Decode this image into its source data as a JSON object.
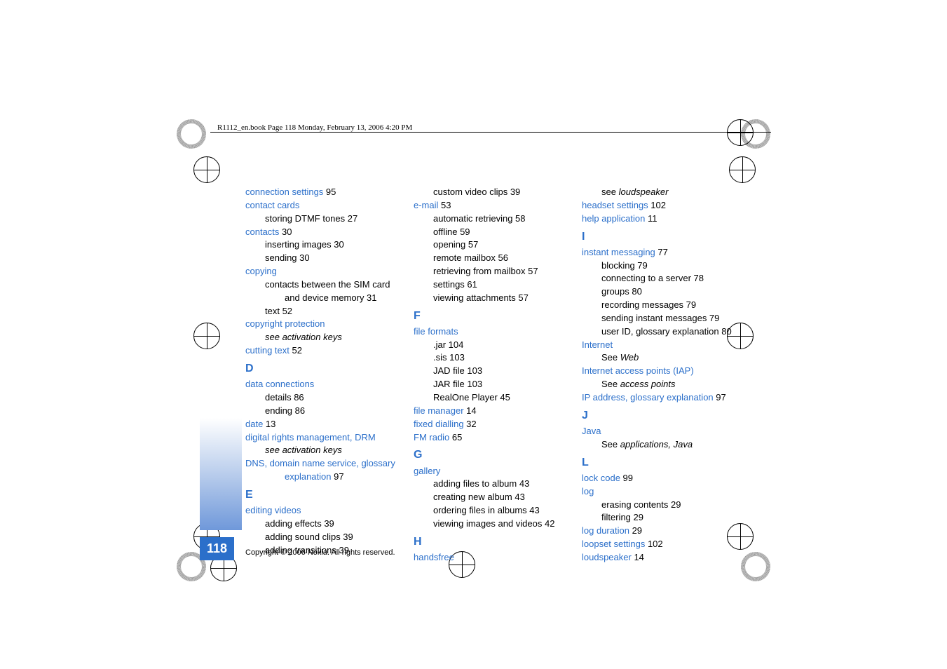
{
  "header": "R1112_en.book  Page 118  Monday, February 13, 2006  4:20 PM",
  "page_number": "118",
  "copyright": "Copyright © 2006 Nokia. All rights reserved.",
  "col1": [
    {
      "cls": "link",
      "txt": "connection settings",
      "pg": " 95"
    },
    {
      "cls": "link",
      "txt": "contact cards"
    },
    {
      "cls": "indent1",
      "txt": "storing DTMF tones 27"
    },
    {
      "cls": "link",
      "txt": "contacts",
      "pg": " 30"
    },
    {
      "cls": "indent1",
      "txt": "inserting images 30"
    },
    {
      "cls": "indent1",
      "txt": "sending 30"
    },
    {
      "cls": "link",
      "txt": "copying"
    },
    {
      "cls": "indent1",
      "txt": "contacts between the SIM card"
    },
    {
      "cls": "indent2",
      "txt": "and device memory 31"
    },
    {
      "cls": "indent1",
      "txt": "text 52"
    },
    {
      "cls": "link",
      "txt": "copyright protection"
    },
    {
      "cls": "indent1 ital",
      "txt": "see activation keys"
    },
    {
      "cls": "link",
      "txt": "cutting text",
      "pg": " 52"
    },
    {
      "cls": "sect",
      "txt": "D"
    },
    {
      "cls": "link",
      "txt": "data connections"
    },
    {
      "cls": "indent1",
      "txt": "details 86"
    },
    {
      "cls": "indent1",
      "txt": "ending 86"
    },
    {
      "cls": "link",
      "txt": "date",
      "pg": " 13"
    },
    {
      "cls": "link",
      "txt": "digital rights management, DRM"
    },
    {
      "cls": "indent1 ital",
      "txt": "see activation keys"
    },
    {
      "cls": "link",
      "txt": "DNS, domain name service, glossary"
    },
    {
      "cls": "link indent2",
      "txt": "explanation",
      "pg": " 97"
    },
    {
      "cls": "sect",
      "txt": "E"
    },
    {
      "cls": "link",
      "txt": "editing videos"
    },
    {
      "cls": "indent1",
      "txt": "adding effects 39"
    },
    {
      "cls": "indent1",
      "txt": "adding sound clips 39"
    },
    {
      "cls": "indent1",
      "txt": "adding transitions 39"
    }
  ],
  "col2": [
    {
      "cls": "indent1",
      "txt": "custom video clips 39"
    },
    {
      "cls": "link",
      "txt": "e-mail",
      "pg": " 53"
    },
    {
      "cls": "indent1",
      "txt": "automatic retrieving 58"
    },
    {
      "cls": "indent1",
      "txt": "offline 59"
    },
    {
      "cls": "indent1",
      "txt": "opening 57"
    },
    {
      "cls": "indent1",
      "txt": "remote mailbox 56"
    },
    {
      "cls": "indent1",
      "txt": "retrieving from mailbox 57"
    },
    {
      "cls": "indent1",
      "txt": "settings 61"
    },
    {
      "cls": "indent1",
      "txt": "viewing attachments 57"
    },
    {
      "cls": "sect",
      "txt": "F"
    },
    {
      "cls": "link",
      "txt": "file formats"
    },
    {
      "cls": "indent1",
      "txt": ".jar 104"
    },
    {
      "cls": "indent1",
      "txt": ".sis 103"
    },
    {
      "cls": "indent1",
      "txt": "JAD file 103"
    },
    {
      "cls": "indent1",
      "txt": "JAR file 103"
    },
    {
      "cls": "indent1",
      "txt": "RealOne Player 45"
    },
    {
      "cls": "link",
      "txt": "file manager",
      "pg": " 14"
    },
    {
      "cls": "link",
      "txt": "fixed dialling",
      "pg": " 32"
    },
    {
      "cls": "link",
      "txt": "FM radio",
      "pg": " 65"
    },
    {
      "cls": "sect",
      "txt": "G"
    },
    {
      "cls": "link",
      "txt": "gallery"
    },
    {
      "cls": "indent1",
      "txt": "adding files to album 43"
    },
    {
      "cls": "indent1",
      "txt": "creating new album 43"
    },
    {
      "cls": "indent1",
      "txt": "ordering files in albums 43"
    },
    {
      "cls": "indent1",
      "txt": "viewing images and videos 42"
    },
    {
      "cls": "sect",
      "txt": "H"
    },
    {
      "cls": "link",
      "txt": "handsfree"
    }
  ],
  "col3": [
    {
      "cls": "indent1",
      "pre": "see ",
      "ital": "loudspeaker"
    },
    {
      "cls": "link",
      "txt": "headset settings",
      "pg": " 102"
    },
    {
      "cls": "link",
      "txt": "help application",
      "pg": " 11"
    },
    {
      "cls": "sect",
      "txt": "I"
    },
    {
      "cls": "link",
      "txt": "instant messaging",
      "pg": " 77"
    },
    {
      "cls": "indent1",
      "txt": "blocking 79"
    },
    {
      "cls": "indent1",
      "txt": "connecting to a server 78"
    },
    {
      "cls": "indent1",
      "txt": "groups 80"
    },
    {
      "cls": "indent1",
      "txt": "recording messages 79"
    },
    {
      "cls": "indent1",
      "txt": "sending instant messages 79"
    },
    {
      "cls": "indent1",
      "txt": "user ID, glossary explanation 80"
    },
    {
      "cls": "link",
      "txt": "Internet"
    },
    {
      "cls": "indent1",
      "pre": "See ",
      "ital": "Web"
    },
    {
      "cls": "link",
      "txt": "Internet access points (IAP)"
    },
    {
      "cls": "indent1",
      "pre": "See ",
      "ital": "access points"
    },
    {
      "cls": "link",
      "txt": "IP address, glossary explanation",
      "pg": " 97"
    },
    {
      "cls": "sect",
      "txt": "J"
    },
    {
      "cls": "link",
      "txt": "Java"
    },
    {
      "cls": "indent1",
      "pre": "See ",
      "ital": "applications, Java"
    },
    {
      "cls": "sect",
      "txt": "L"
    },
    {
      "cls": "link",
      "txt": "lock code",
      "pg": " 99"
    },
    {
      "cls": "link",
      "txt": "log"
    },
    {
      "cls": "indent1",
      "txt": "erasing contents 29"
    },
    {
      "cls": "indent1",
      "txt": "filtering 29"
    },
    {
      "cls": "link",
      "txt": "log duration",
      "pg": " 29"
    },
    {
      "cls": "link",
      "txt": "loopset settings",
      "pg": " 102"
    },
    {
      "cls": "link",
      "txt": "loudspeaker",
      "pg": " 14"
    }
  ]
}
